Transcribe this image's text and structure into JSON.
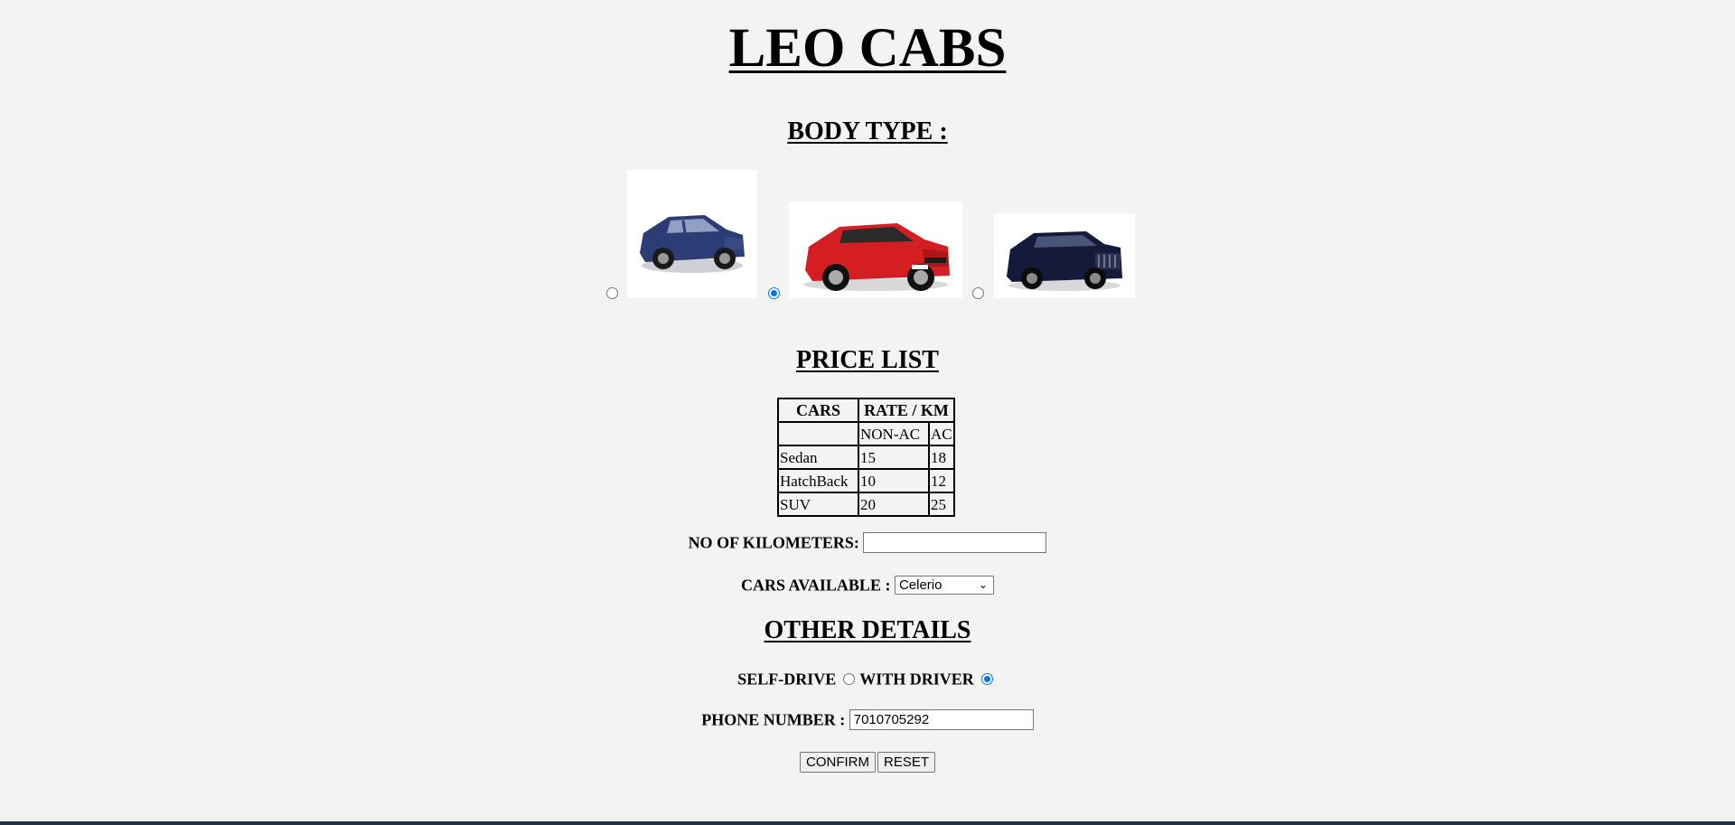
{
  "title": "LEO CABS",
  "body_type": {
    "heading": "BODY TYPE :",
    "options": [
      {
        "name": "sedan-car",
        "checked": false
      },
      {
        "name": "hatchback-car",
        "checked": true
      },
      {
        "name": "suv-car",
        "checked": false
      }
    ]
  },
  "price_list": {
    "heading": "PRICE LIST",
    "header": {
      "cars": "CARS",
      "rate": "RATE / KM"
    },
    "subheader": {
      "non_ac": "NON-AC",
      "ac": "AC"
    },
    "rows": [
      {
        "car": "Sedan",
        "non_ac": "15",
        "ac": "18"
      },
      {
        "car": "HatchBack",
        "non_ac": "10",
        "ac": "12"
      },
      {
        "car": "SUV",
        "non_ac": "20",
        "ac": "25"
      }
    ]
  },
  "kilometers": {
    "label": "NO OF KILOMETERS:",
    "value": ""
  },
  "cars_available": {
    "label": "CARS AVAILABLE :",
    "selected": "Celerio"
  },
  "other_details": {
    "heading": "OTHER DETAILS",
    "self_drive_label": "SELF-DRIVE",
    "with_driver_label": "WITH DRIVER",
    "self_drive_checked": false,
    "with_driver_checked": true
  },
  "phone": {
    "label": "PHONE NUMBER :",
    "value": "7010705292"
  },
  "buttons": {
    "confirm": "CONFIRM",
    "reset": "RESET"
  },
  "colors": {
    "radio_checked": "#0075ff",
    "bottom_strip": "#1e3347"
  }
}
